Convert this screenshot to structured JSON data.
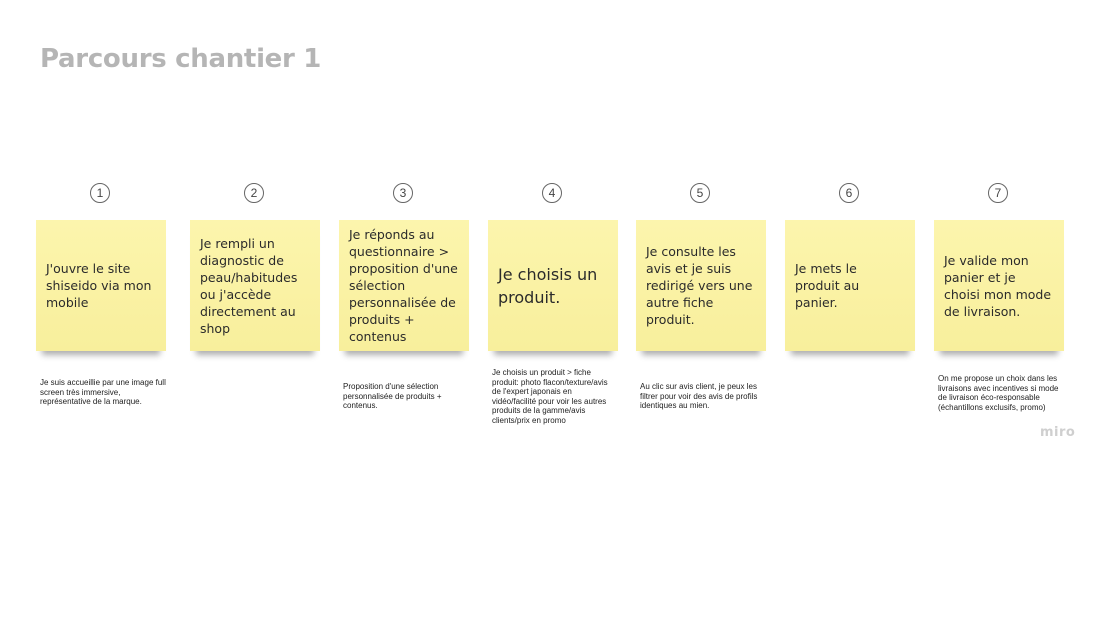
{
  "title": "Parcours chantier 1",
  "watermark": "miro",
  "colors": {
    "note": "#fbf3a8",
    "title": "#b5b5b5",
    "watermark": "#cfcfcf"
  },
  "steps": [
    {
      "number": "1",
      "note": "J'ouvre le site shiseido via mon mobile",
      "caption": "Je suis accueillie par une image full screen très immersive, représentative de la marque."
    },
    {
      "number": "2",
      "note": "Je rempli un diagnostic de peau/habitudes ou j'accède directement au shop",
      "caption": ""
    },
    {
      "number": "3",
      "note": "Je réponds au questionnaire > proposition d'une sélection personnalisée de produits + contenus",
      "caption": "Proposition d'une sélection personnalisée de produits + contenus."
    },
    {
      "number": "4",
      "note": "Je choisis un produit.",
      "caption": "Je choisis un produit > fiche produit: photo flacon/texture/avis de l'expert japonais en vidéo/facilité pour voir les autres produits de la gamme/avis clients/prix en promo"
    },
    {
      "number": "5",
      "note": "Je consulte les avis et je suis redirigé vers une autre fiche produit.",
      "caption": "Au clic sur avis client, je peux les filtrer pour voir des avis de profils identiques au mien."
    },
    {
      "number": "6",
      "note": "Je mets le produit au panier.",
      "caption": ""
    },
    {
      "number": "7",
      "note": "Je valide mon panier et je choisi mon mode de livraison.",
      "caption": "On me propose un choix dans les livraisons avec incentives si mode de livraison éco-responsable (échantillons exclusifs, promo)"
    }
  ]
}
